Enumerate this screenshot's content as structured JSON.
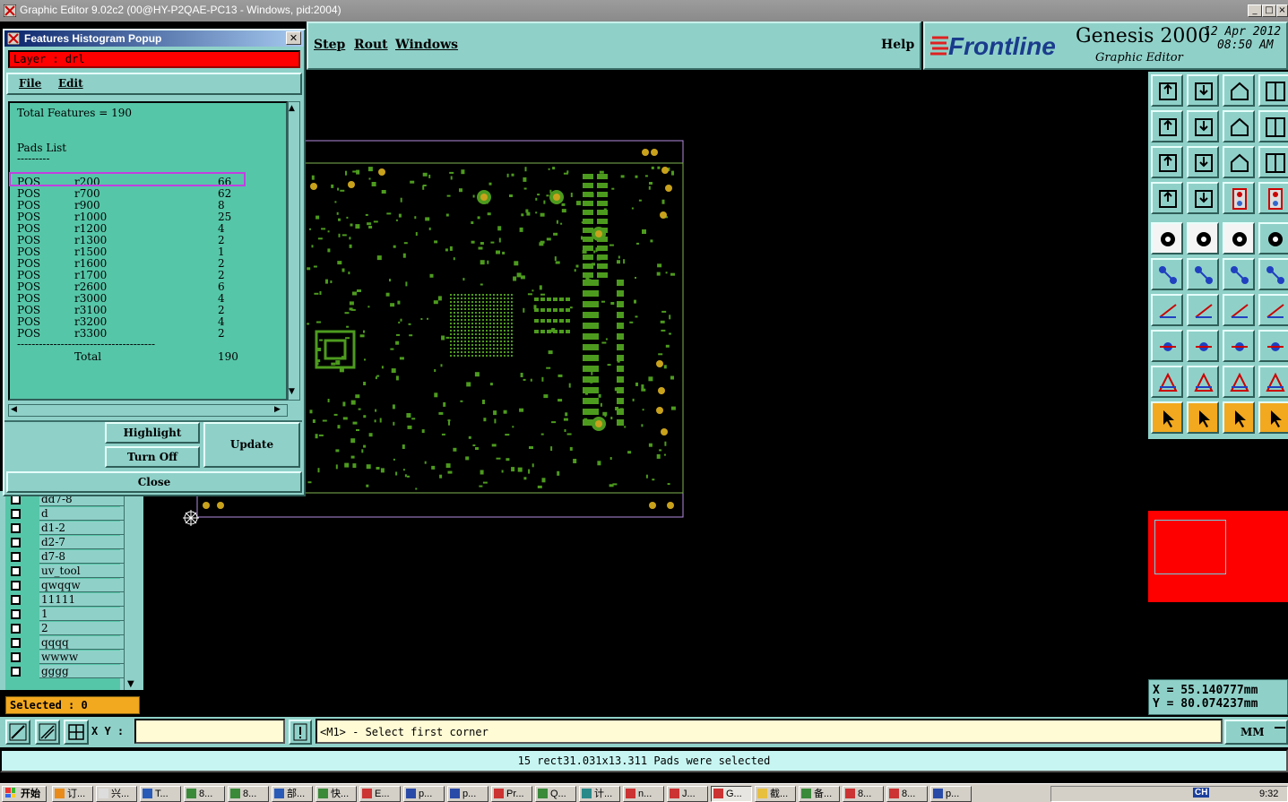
{
  "window": {
    "title": "Graphic Editor 9.02c2 (00@HY-P2QAE-PC13 - Windows, pid:2004)"
  },
  "menubar": {
    "items": [
      "Step",
      "Rout",
      "Windows"
    ],
    "help": "Help"
  },
  "branding": {
    "logo": "Frontline",
    "product": "Genesis 2000",
    "subtitle": "Graphic Editor",
    "date": "12 Apr 2012",
    "time": "08:50 AM"
  },
  "popup": {
    "title": "Features Histogram Popup",
    "layer_label": "Layer :  drl",
    "menu": [
      "File",
      "Edit"
    ],
    "total_features": "Total Features = 190",
    "list_title": "Pads List",
    "underline": "---------",
    "rows": [
      {
        "pos": "POS",
        "sym": "r200",
        "count": "66"
      },
      {
        "pos": "POS",
        "sym": "r700",
        "count": "62"
      },
      {
        "pos": "POS",
        "sym": "r900",
        "count": "8"
      },
      {
        "pos": "POS",
        "sym": "r1000",
        "count": "25"
      },
      {
        "pos": "POS",
        "sym": "r1200",
        "count": "4"
      },
      {
        "pos": "POS",
        "sym": "r1300",
        "count": "2"
      },
      {
        "pos": "POS",
        "sym": "r1500",
        "count": "1"
      },
      {
        "pos": "POS",
        "sym": "r1600",
        "count": "2"
      },
      {
        "pos": "POS",
        "sym": "r1700",
        "count": "2"
      },
      {
        "pos": "POS",
        "sym": "r2600",
        "count": "6"
      },
      {
        "pos": "POS",
        "sym": "r3000",
        "count": "4"
      },
      {
        "pos": "POS",
        "sym": "r3100",
        "count": "2"
      },
      {
        "pos": "POS",
        "sym": "r3200",
        "count": "4"
      },
      {
        "pos": "POS",
        "sym": "r3300",
        "count": "2"
      }
    ],
    "separator": "--------------------------------------",
    "total_label": "Total",
    "total_value": "190",
    "highlight_label": "Highlight",
    "turnoff_label": "Turn Off",
    "update_label": "Update",
    "close_label": "Close"
  },
  "layers": [
    "dd7-8",
    "d",
    "d1-2",
    "d2-7",
    "d7-8",
    "uv_tool",
    "qwqqw",
    "11111",
    "1",
    "2",
    "qqqq",
    "wwww",
    "gggg"
  ],
  "selected": "Selected : 0",
  "coords": {
    "x": "X  =  55.140777mm",
    "y": "Y  =  80.074237mm"
  },
  "commandbar": {
    "xy_label": "X Y :",
    "xy_value": "",
    "prompt": "<M1> - Select first corner",
    "units": "MM"
  },
  "status": "15 rect31.031x13.311 Pads were selected",
  "taskbar": {
    "start": "开始",
    "tasks": [
      "订...",
      "兴...",
      "T...",
      "8...",
      "8...",
      "部...",
      "快...",
      "E...",
      "p...",
      "p...",
      "Pr...",
      "Q...",
      "计...",
      "n...",
      "J...",
      "G...",
      "截...",
      "备...",
      "8...",
      "8...",
      "p..."
    ],
    "clock": "9:32",
    "tray": "CH"
  }
}
